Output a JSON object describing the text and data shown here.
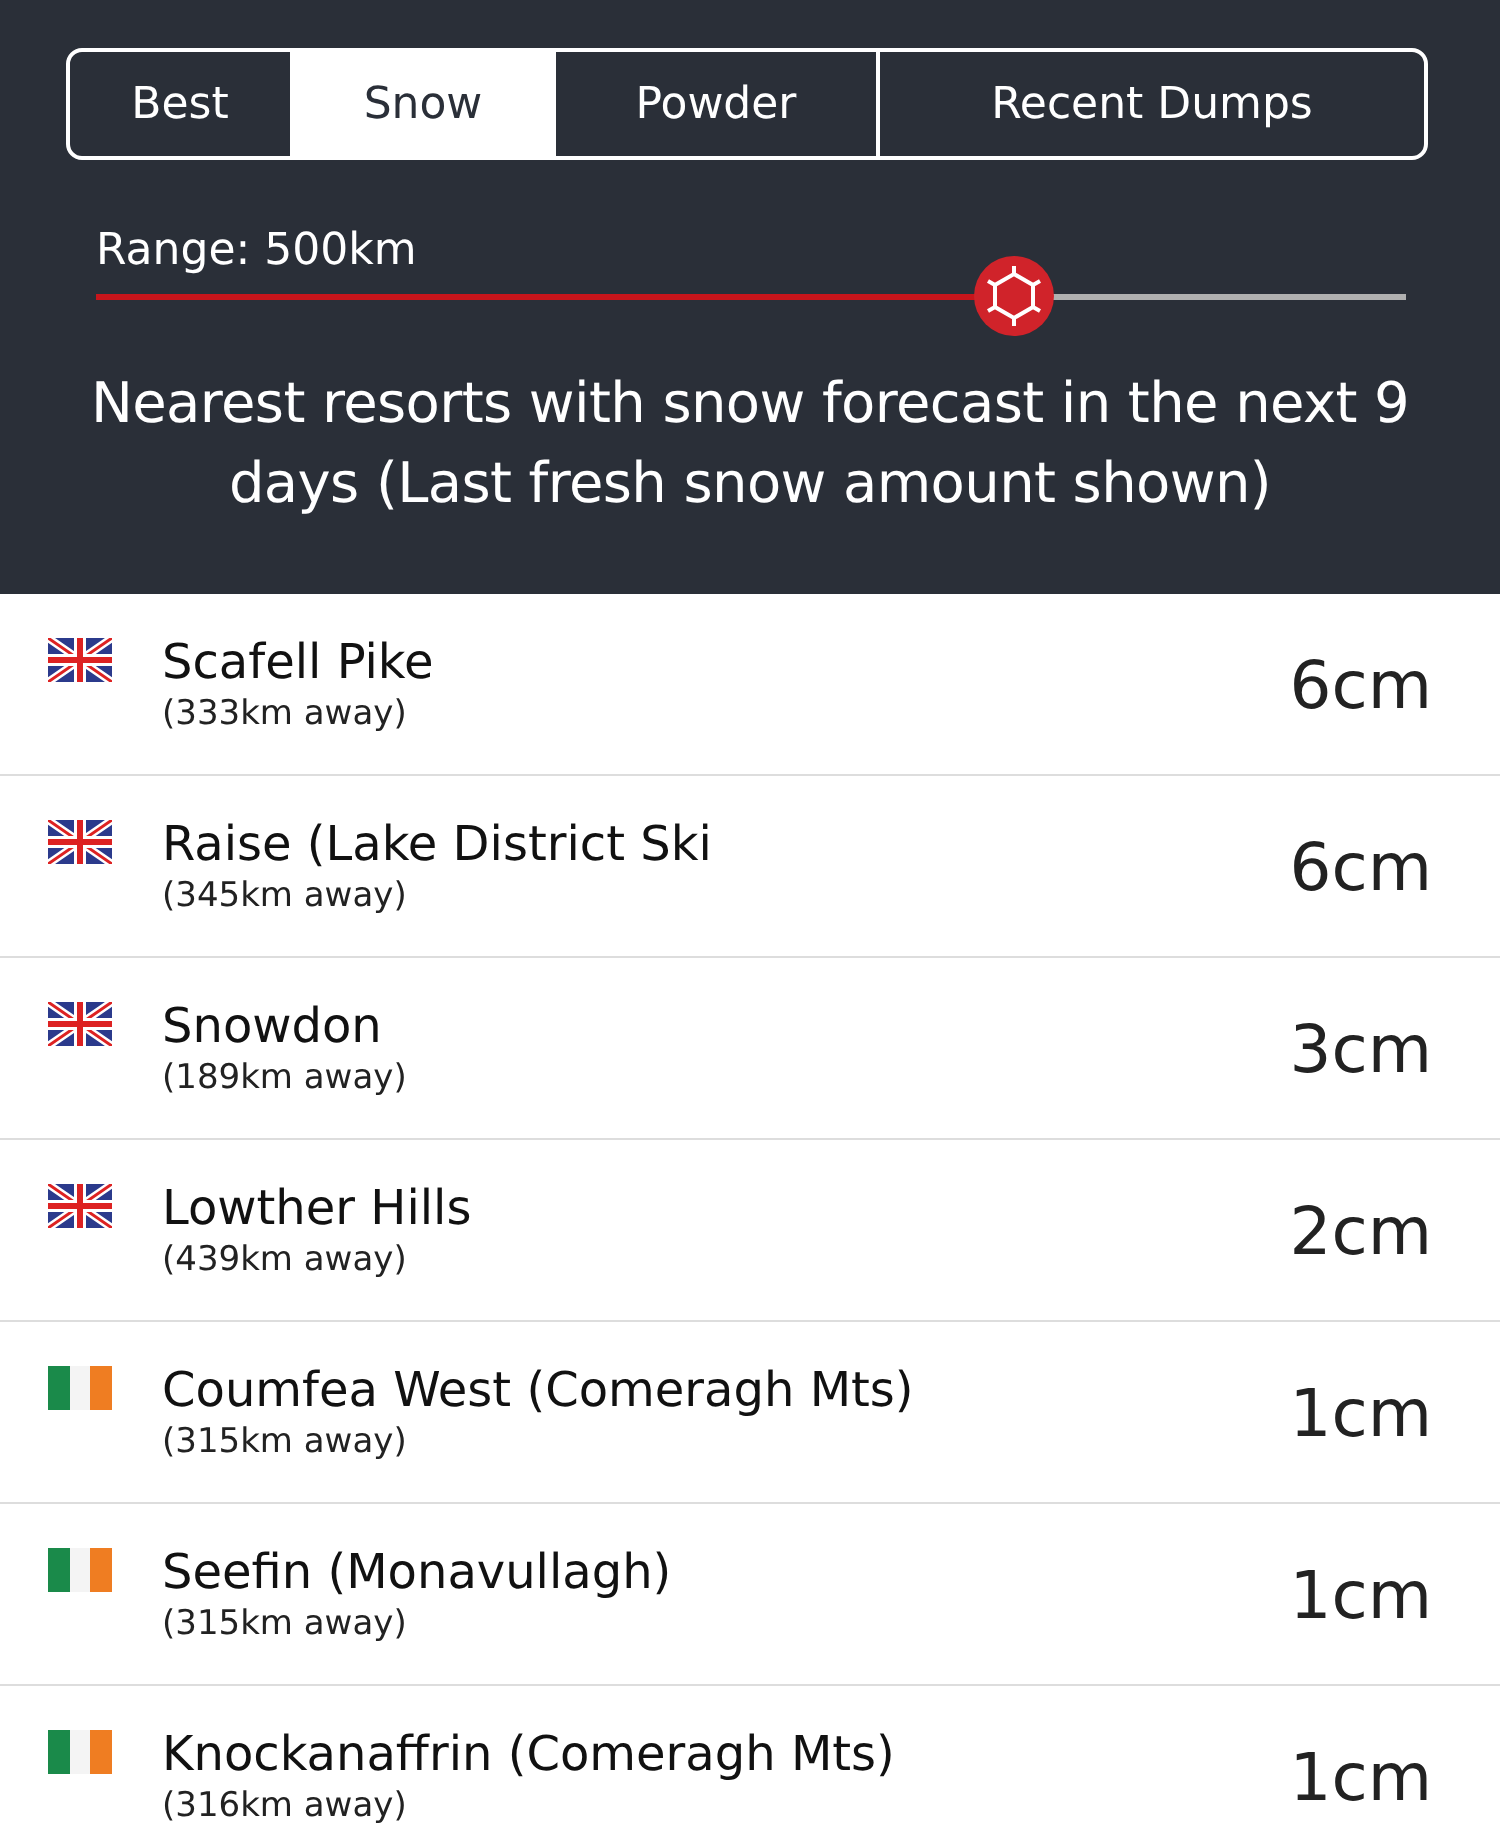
{
  "tabs": [
    {
      "label": "Best",
      "selected": false
    },
    {
      "label": "Snow",
      "selected": true
    },
    {
      "label": "Powder",
      "selected": false
    },
    {
      "label": "Recent Dumps",
      "selected": false
    }
  ],
  "range": {
    "label": "Range: 500km",
    "level": 0.7
  },
  "description": "Nearest resorts with snow forecast in the next 9 days (Last fresh snow amount shown)",
  "resorts": [
    {
      "kind": "uk",
      "name": "Scafell Pike",
      "distance": "(333km away)",
      "amount": "6cm"
    },
    {
      "kind": "uk",
      "name": "Raise (Lake District Ski",
      "distance": "(345km away)",
      "amount": "6cm"
    },
    {
      "kind": "uk",
      "name": "Snowdon",
      "distance": "(189km away)",
      "amount": "3cm"
    },
    {
      "kind": "uk",
      "name": "Lowther Hills",
      "distance": "(439km away)",
      "amount": "2cm"
    },
    {
      "kind": "ie",
      "name": "Coumfea West (Comeragh Mts)",
      "distance": "(315km away)",
      "amount": "1cm"
    },
    {
      "kind": "ie",
      "name": "Seefin (Monavullagh)",
      "distance": "(315km away)",
      "amount": "1cm"
    },
    {
      "kind": "ie",
      "name": "Knockanaffrin (Comeragh Mts)",
      "distance": "(316km away)",
      "amount": "1cm"
    }
  ]
}
